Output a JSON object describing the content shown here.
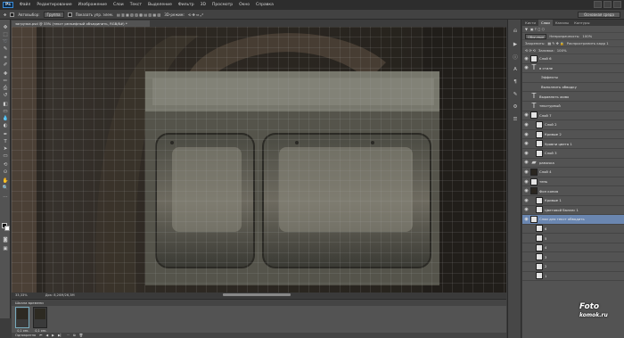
{
  "app": {
    "logo": "Ps",
    "menus": [
      "Файл",
      "Редактирование",
      "Изображение",
      "Слои",
      "Текст",
      "Выделение",
      "Фильтр",
      "3D",
      "Просмотр",
      "Окно",
      "Справка"
    ]
  },
  "options": {
    "autoselect_label": "Автовыбор:",
    "autoselect_value": "Группа",
    "transform_label": "Показать упр. элем.",
    "mode_label": "3D-режим:",
    "workspace": "Основная среда"
  },
  "document": {
    "tab": "загрузка.psd @ 33% (текст рельефный объединить, RGB/8#) *",
    "zoom": "33,33%",
    "doc_info": "Док: 8,20М/26,3М"
  },
  "history": {
    "title": "Шкала времени",
    "frames": [
      {
        "label": "0,1 сек."
      },
      {
        "label": "0,1 сек."
      }
    ],
    "loop": "Однократно"
  },
  "panels": {
    "tabs": [
      "Кисти",
      "Слои",
      "Каналы",
      "Контуры"
    ],
    "active_tab": "Слои",
    "blend_mode": "Обычные",
    "opacity_label": "Непрозрачность:",
    "opacity": "100%",
    "lock_label": "Закрепить:",
    "propagate_label": "Распространить кадр 1",
    "fill_label": "Заливка:",
    "fill": "100%"
  },
  "layers": [
    {
      "name": "Слой 6",
      "thumb": "light",
      "eye": true,
      "indent": 0
    },
    {
      "name": "в стиле",
      "thumb": "text",
      "eye": true,
      "indent": 0
    },
    {
      "name": "Эффекты",
      "thumb": "none",
      "eye": false,
      "indent": 2
    },
    {
      "name": "Выполнить обводку",
      "thumb": "none",
      "eye": false,
      "indent": 2
    },
    {
      "name": "Выравнять живо",
      "thumb": "text",
      "eye": false,
      "indent": 0
    },
    {
      "name": "текстурный",
      "thumb": "text",
      "eye": false,
      "indent": 0
    },
    {
      "name": "Слой 7",
      "thumb": "light",
      "eye": true,
      "indent": 0
    },
    {
      "name": "Слой 2",
      "thumb": "light",
      "eye": true,
      "indent": 1
    },
    {
      "name": "Кривые 2",
      "thumb": "light",
      "eye": true,
      "indent": 1
    },
    {
      "name": "Уровни цвета 1",
      "thumb": "light",
      "eye": true,
      "indent": 1
    },
    {
      "name": "Слой 3",
      "thumb": "light",
      "eye": true,
      "indent": 1
    },
    {
      "name": "рамочка",
      "thumb": "folder",
      "eye": true,
      "indent": 0
    },
    {
      "name": "Слой 4",
      "thumb": "dark",
      "eye": true,
      "indent": 0
    },
    {
      "name": "тень",
      "thumb": "light",
      "eye": true,
      "indent": 0
    },
    {
      "name": "Фон копия",
      "thumb": "dark",
      "eye": true,
      "indent": 0
    },
    {
      "name": "Кривые 1",
      "thumb": "light",
      "eye": true,
      "indent": 1
    },
    {
      "name": "Цветовой баланс 1",
      "thumb": "light",
      "eye": true,
      "indent": 1
    },
    {
      "name": "Слои для текст обводить",
      "thumb": "light",
      "eye": true,
      "indent": 0,
      "active": true
    },
    {
      "name": "6",
      "thumb": "light",
      "eye": false,
      "indent": 1
    },
    {
      "name": "5",
      "thumb": "light",
      "eye": false,
      "indent": 1
    },
    {
      "name": "4",
      "thumb": "light",
      "eye": false,
      "indent": 1
    },
    {
      "name": "3",
      "thumb": "light",
      "eye": false,
      "indent": 1
    },
    {
      "name": "2",
      "thumb": "light",
      "eye": false,
      "indent": 1
    },
    {
      "name": "1",
      "thumb": "light",
      "eye": false,
      "indent": 1
    }
  ],
  "watermark": {
    "line1": "Foto",
    "line2": "komok.ru"
  }
}
